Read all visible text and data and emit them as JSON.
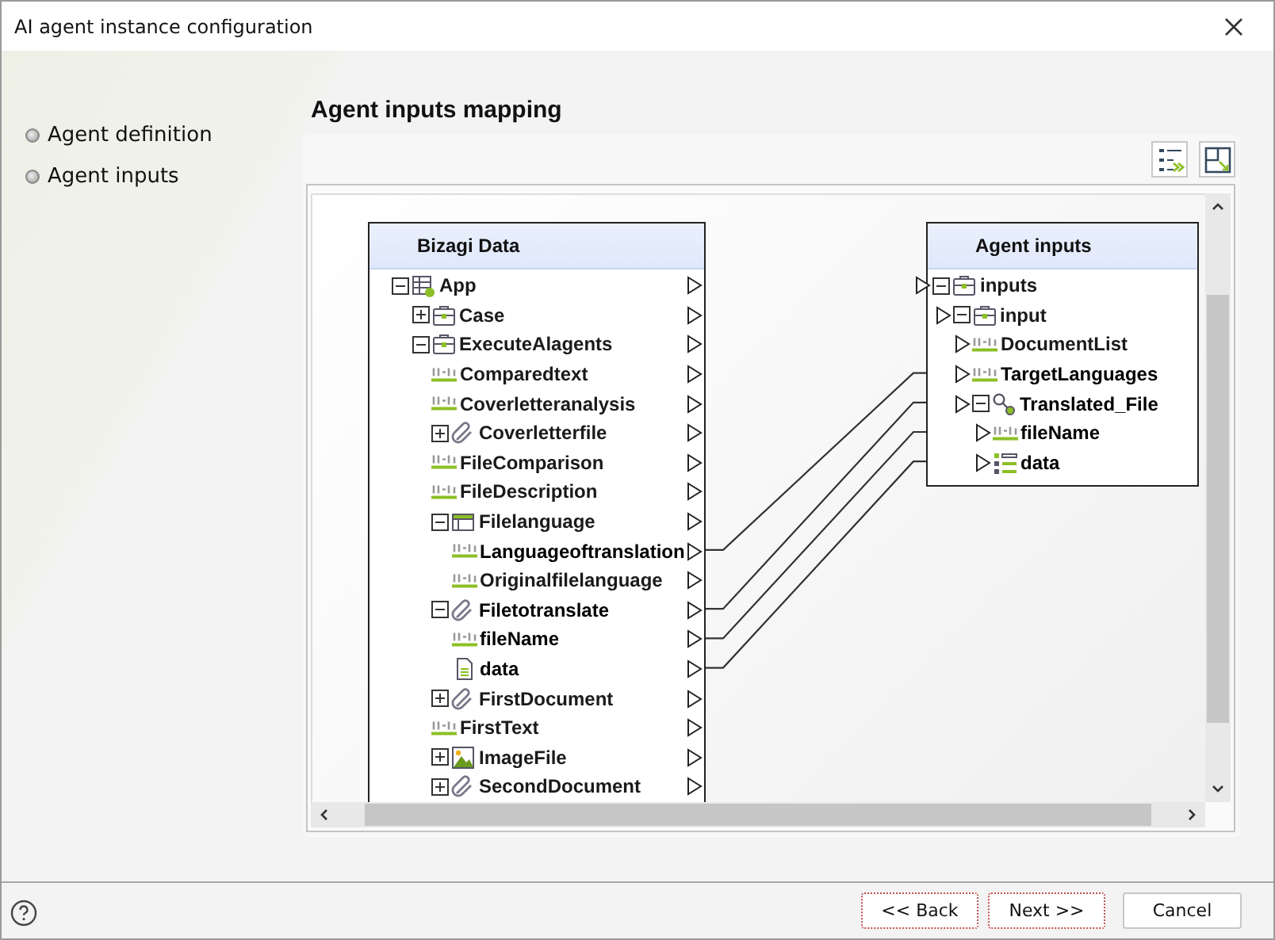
{
  "window": {
    "title": "AI agent instance configuration"
  },
  "steps": [
    {
      "label": "Agent definition"
    },
    {
      "label": "Agent inputs"
    }
  ],
  "heading": "Agent inputs mapping",
  "source": {
    "title": "Bizagi Data",
    "tree": [
      {
        "label": "App",
        "kind": "table",
        "expanded": true,
        "mapped": false,
        "children": [
          {
            "label": "Case",
            "kind": "entity",
            "expanded": false,
            "mapped": false
          },
          {
            "label": "ExecuteAlagents",
            "kind": "entity",
            "expanded": true,
            "mapped": false,
            "children": [
              {
                "label": "Comparedtext",
                "kind": "text",
                "mapped": false
              },
              {
                "label": "Coverletteranalysis",
                "kind": "text",
                "mapped": false
              },
              {
                "label": "Coverletterfile",
                "kind": "attachment",
                "expanded": false,
                "mapped": false
              },
              {
                "label": "FileComparison",
                "kind": "text",
                "mapped": false
              },
              {
                "label": "FileDescription",
                "kind": "text",
                "mapped": false
              },
              {
                "label": "Filelanguage",
                "kind": "grid",
                "expanded": true,
                "mapped": false,
                "children": [
                  {
                    "label": "Languageoftranslation",
                    "kind": "text",
                    "mapped": true
                  },
                  {
                    "label": "Originalfilelanguage",
                    "kind": "text",
                    "mapped": false
                  }
                ]
              },
              {
                "label": "Filetotranslate",
                "kind": "attachment",
                "expanded": true,
                "mapped": true,
                "children": [
                  {
                    "label": "fileName",
                    "kind": "text",
                    "mapped": true
                  },
                  {
                    "label": "data",
                    "kind": "file",
                    "mapped": true
                  }
                ]
              },
              {
                "label": "FirstDocument",
                "kind": "attachment",
                "expanded": false,
                "mapped": false
              },
              {
                "label": "FirstText",
                "kind": "text",
                "mapped": false
              },
              {
                "label": "ImageFile",
                "kind": "image",
                "expanded": false,
                "mapped": false
              },
              {
                "label": "SecondDocument",
                "kind": "attachment",
                "expanded": false,
                "mapped": false
              }
            ]
          }
        ]
      }
    ]
  },
  "target": {
    "title": "Agent inputs",
    "tree": [
      {
        "label": "inputs",
        "kind": "entity",
        "expanded": true,
        "mapped": false,
        "children": [
          {
            "label": "input",
            "kind": "entity",
            "expanded": true,
            "mapped": false,
            "children": [
              {
                "label": "DocumentList",
                "kind": "text",
                "mapped": false
              },
              {
                "label": "TargetLanguages",
                "kind": "text",
                "mapped": true
              },
              {
                "label": "Translated_File",
                "kind": "relation",
                "expanded": true,
                "mapped": true,
                "children": [
                  {
                    "label": "fileName",
                    "kind": "text",
                    "mapped": true
                  },
                  {
                    "label": "data",
                    "kind": "list",
                    "mapped": true
                  }
                ]
              }
            ]
          }
        ]
      }
    ]
  },
  "buttons": [
    {
      "label": "<< Back"
    },
    {
      "label": "Next >>"
    },
    {
      "label": "Cancel"
    }
  ]
}
